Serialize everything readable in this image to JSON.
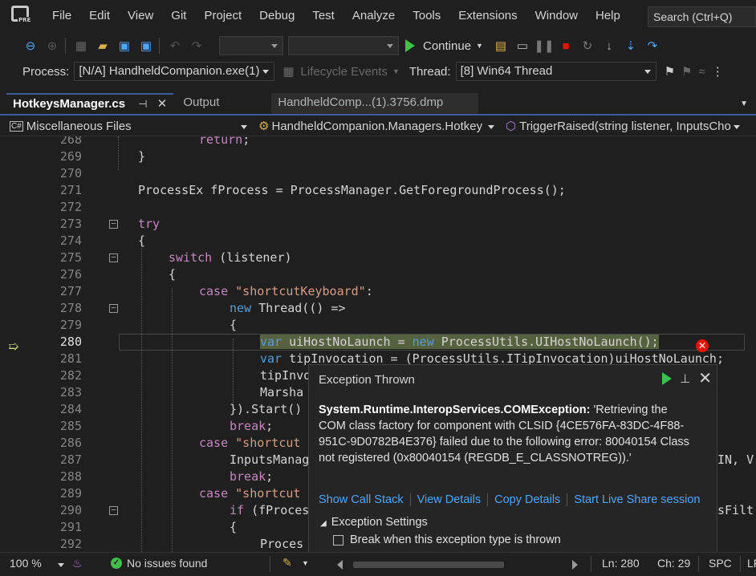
{
  "menu": {
    "items": [
      "File",
      "Edit",
      "View",
      "Git",
      "Project",
      "Debug",
      "Test",
      "Analyze",
      "Tools",
      "Extensions",
      "Window",
      "Help"
    ],
    "search_placeholder": "Search (Ctrl+Q)",
    "logo_badge": "PRE"
  },
  "toolbar": {
    "continue_label": "Continue"
  },
  "debug_location": {
    "process_label": "Process:",
    "process_value": "[N/A] HandheldCompanion.exe(1)",
    "lifecycle_label": "Lifecycle Events",
    "thread_label": "Thread:",
    "thread_value": "[8] Win64 Thread"
  },
  "tabs": [
    {
      "label": "HotkeysManager.cs",
      "active": true,
      "pin": "⊣",
      "close": "✕"
    },
    {
      "label": "Output",
      "active": false
    },
    {
      "label": "HandheldComp...(1).3756.dmp",
      "active": false
    }
  ],
  "navbar": {
    "project_icon": "C#",
    "project": "Miscellaneous Files",
    "type": "HandheldCompanion.Managers.Hotkey",
    "member": "TriggerRaised(string listener, InputsCho"
  },
  "editor": {
    "current_line": 280,
    "lines": [
      {
        "n": "268",
        "text": "            return;"
      },
      {
        "n": "269",
        "text": "        }"
      },
      {
        "n": "270",
        "text": ""
      },
      {
        "n": "271",
        "text": "ProcessEx fProcess = ProcessManager.GetForegroundProcess();"
      },
      {
        "n": "272",
        "text": ""
      },
      {
        "n": "273",
        "text": "try"
      },
      {
        "n": "274",
        "text": "{"
      },
      {
        "n": "275",
        "text": "    switch (listener)"
      },
      {
        "n": "276",
        "text": "    {"
      },
      {
        "n": "277",
        "text": "        case \"shortcutKeyboard\":"
      },
      {
        "n": "278",
        "text": "            new Thread(() =>"
      },
      {
        "n": "279",
        "text": "            {"
      },
      {
        "n": "280",
        "text": "                var uiHostNoLaunch = new ProcessUtils.UIHostNoLaunch();"
      },
      {
        "n": "281",
        "text": "                var tipInvocation = (ProcessUtils.ITipInvocation)uiHostNoLaunch;"
      },
      {
        "n": "282",
        "text": "                tipInvo"
      },
      {
        "n": "283",
        "text": "                Marsha"
      },
      {
        "n": "284",
        "text": "            }).Start()"
      },
      {
        "n": "285",
        "text": "            break;"
      },
      {
        "n": "286",
        "text": "        case \"shortcut"
      },
      {
        "n": "287",
        "text": "            InputsManag"
      },
      {
        "n": "288",
        "text": "            break;"
      },
      {
        "n": "289",
        "text": "        case \"shortcut"
      },
      {
        "n": "290",
        "text": "            if (fProces"
      },
      {
        "n": "291",
        "text": "            {"
      },
      {
        "n": "292",
        "text": "                Proces"
      }
    ],
    "right_overflow": {
      "287": "IN, V",
      "290": "sFilt",
      "280": "",
      "281": ""
    }
  },
  "exception_popup": {
    "title": "Exception Thrown",
    "exception_type": "System.Runtime.InteropServices.COMException:",
    "message": " 'Retrieving the COM class factory for component with CLSID {4CE576FA-83DC-4F88-951C-9D0782B4E376} failed due to the following error: 80040154 Class not registered (0x80040154 (REGDB_E_CLASSNOTREG)).'",
    "links": [
      "Show Call Stack",
      "View Details",
      "Copy Details",
      "Start Live Share session"
    ],
    "settings_label": "Exception Settings",
    "checkbox_label": "Break when this exception type is thrown"
  },
  "status": {
    "zoom": "100 %",
    "issues": "No issues found",
    "line": "Ln: 280",
    "col": "Ch: 29",
    "spc": "SPC",
    "eol": "LF"
  },
  "colors": {
    "keyword": "#569cd6",
    "control": "#c586c0",
    "string": "#d69d85",
    "highlight": "#56613f",
    "link": "#4ea6ff",
    "error": "#e51400",
    "play": "#3fbf4b"
  }
}
